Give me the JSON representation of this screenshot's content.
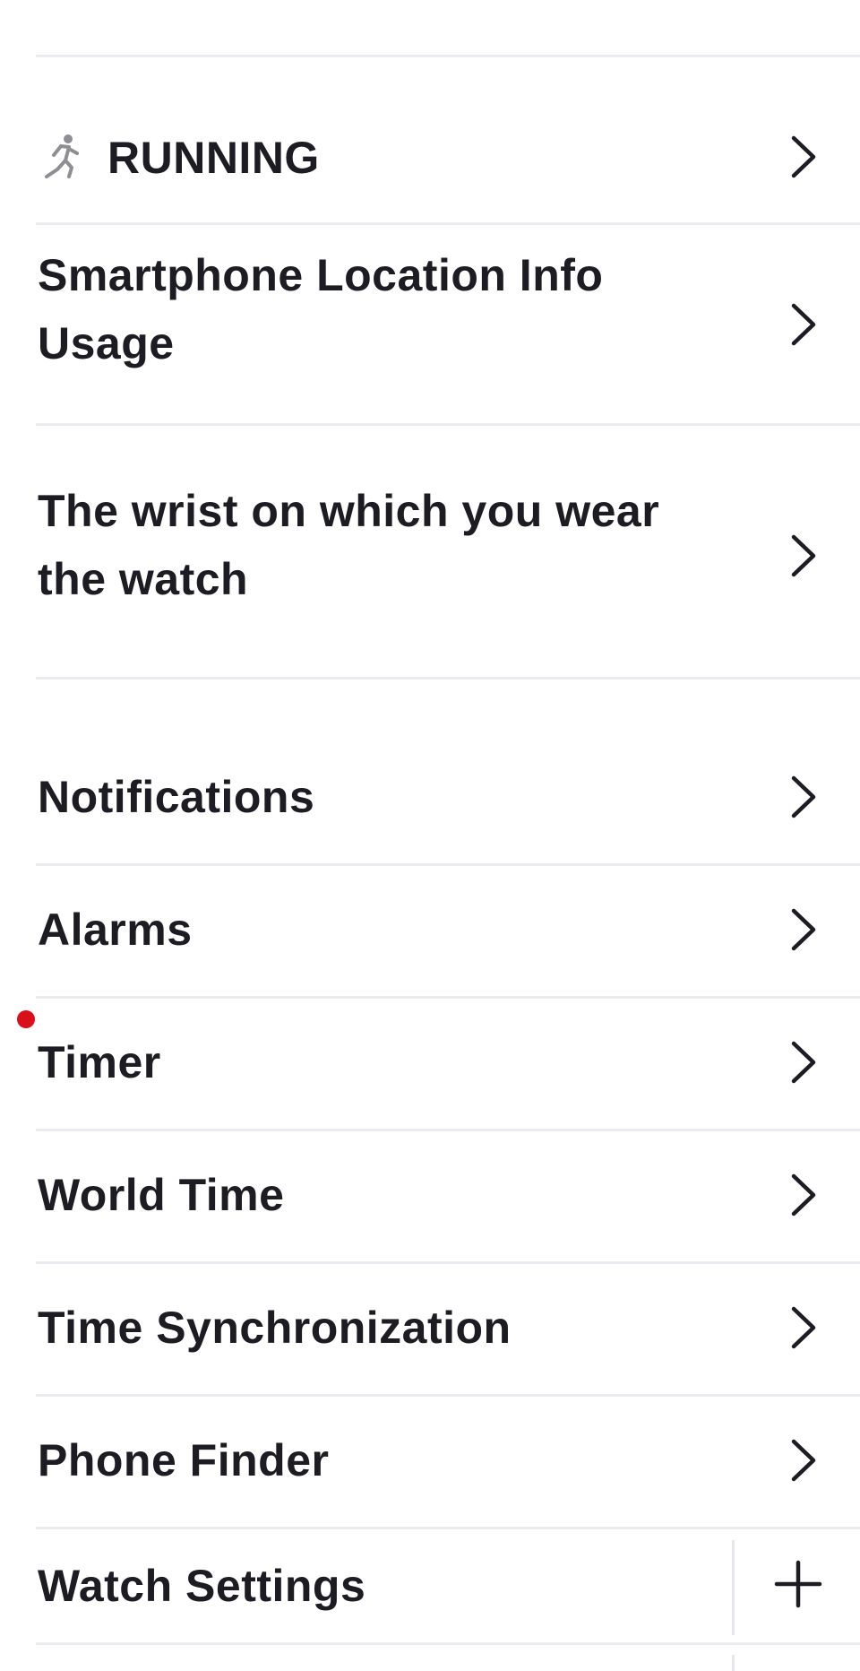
{
  "menu": {
    "items": [
      {
        "key": "running",
        "label": "RUNNING",
        "icon": "running-person-icon",
        "action_icon": "chevron-right-icon"
      },
      {
        "key": "location",
        "label": "Smartphone Location Info\nUsage",
        "action_icon": "chevron-right-icon"
      },
      {
        "key": "wrist",
        "label": "The wrist on which you wear\nthe watch",
        "action_icon": "chevron-right-icon"
      },
      {
        "key": "notifications",
        "label": "Notifications",
        "action_icon": "chevron-right-icon"
      },
      {
        "key": "alarms",
        "label": "Alarms",
        "action_icon": "chevron-right-icon"
      },
      {
        "key": "timer",
        "label": "Timer",
        "action_icon": "chevron-right-icon",
        "badge": "red-dot"
      },
      {
        "key": "world_time",
        "label": "World Time",
        "action_icon": "chevron-right-icon"
      },
      {
        "key": "time_sync",
        "label": "Time Synchronization",
        "action_icon": "chevron-right-icon"
      },
      {
        "key": "phone_finder",
        "label": "Phone Finder",
        "action_icon": "chevron-right-icon"
      },
      {
        "key": "watch_settings",
        "label": "Watch Settings",
        "action_icon": "plus-icon"
      }
    ]
  },
  "colors": {
    "text": "#1c1c22",
    "divider": "#ececf0",
    "badge": "#d7101c",
    "icon_gray": "#8e8e93"
  }
}
